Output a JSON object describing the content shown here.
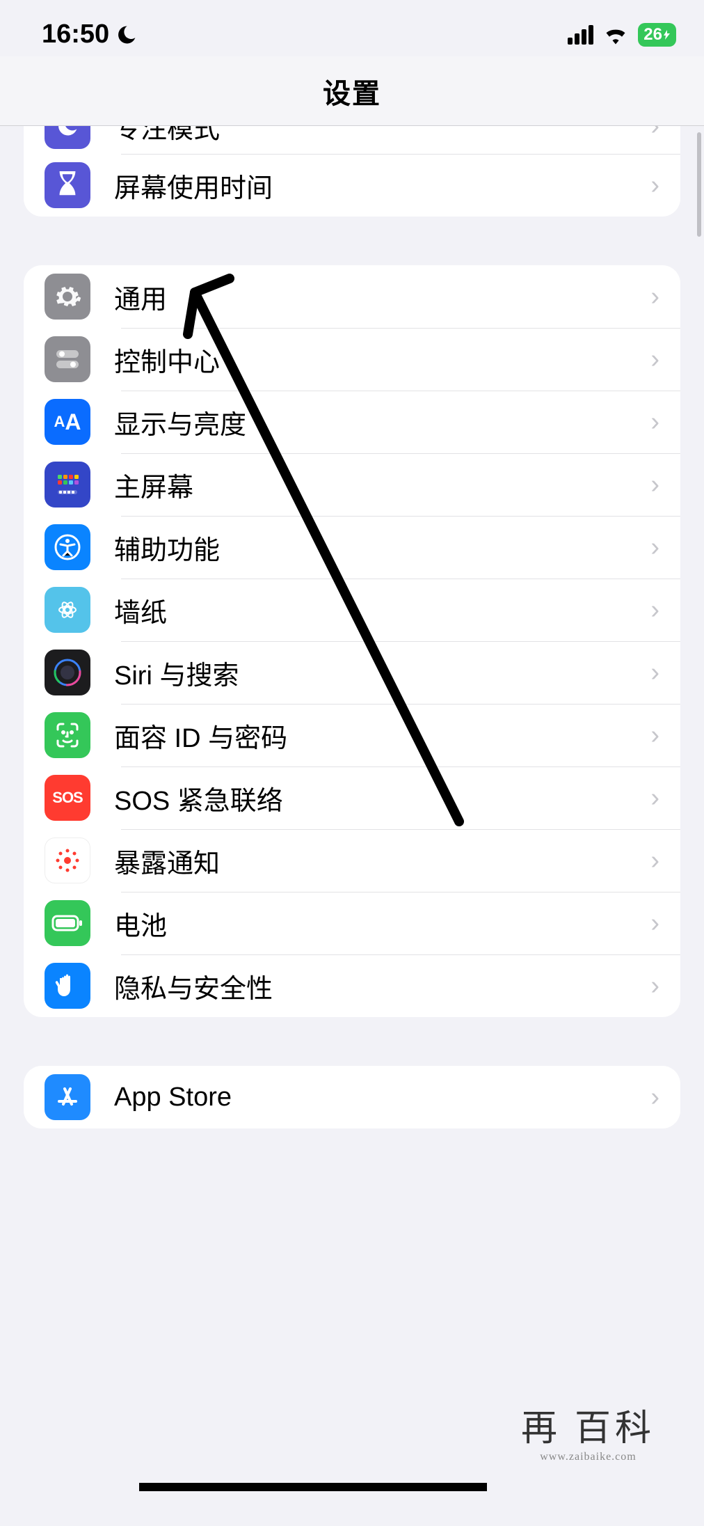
{
  "status": {
    "time": "16:50",
    "battery_text": "26",
    "dnd_icon": "moon-icon"
  },
  "header": {
    "title": "设置"
  },
  "group_top": {
    "items": [
      {
        "id": "focus",
        "label": "专注模式",
        "bg": "#5856d6",
        "icon": "moon"
      },
      {
        "id": "screentime",
        "label": "屏幕使用时间",
        "bg": "#5856d6",
        "icon": "hourglass"
      }
    ]
  },
  "group_main": {
    "items": [
      {
        "id": "general",
        "label": "通用",
        "bg": "#8e8e93",
        "icon": "gear"
      },
      {
        "id": "control-center",
        "label": "控制中心",
        "bg": "#8e8e93",
        "icon": "switches"
      },
      {
        "id": "display",
        "label": "显示与亮度",
        "bg": "#0a84ff",
        "icon": "aa"
      },
      {
        "id": "home-screen",
        "label": "主屏幕",
        "bg": "#3a4fcf",
        "icon": "grid"
      },
      {
        "id": "accessibility",
        "label": "辅助功能",
        "bg": "#0a84ff",
        "icon": "person"
      },
      {
        "id": "wallpaper",
        "label": "墙纸",
        "bg": "#54c3ea",
        "icon": "flower"
      },
      {
        "id": "siri",
        "label": "Siri 与搜索",
        "bg": "#1c1c1e",
        "icon": "siri"
      },
      {
        "id": "faceid",
        "label": "面容 ID 与密码",
        "bg": "#34c759",
        "icon": "faceid"
      },
      {
        "id": "sos",
        "label": "SOS 紧急联络",
        "bg": "#ff3b30",
        "icon": "sos"
      },
      {
        "id": "exposure",
        "label": "暴露通知",
        "bg": "#ffffff",
        "icon": "exposure"
      },
      {
        "id": "battery",
        "label": "电池",
        "bg": "#34c759",
        "icon": "battery"
      },
      {
        "id": "privacy",
        "label": "隐私与安全性",
        "bg": "#0a84ff",
        "icon": "hand"
      }
    ]
  },
  "group_bottom": {
    "items": [
      {
        "id": "appstore",
        "label": "App Store",
        "bg": "#0a84ff",
        "icon": "appstore"
      }
    ]
  },
  "watermark": {
    "main": "再 百科",
    "sub": "www.zaibaike.com"
  }
}
